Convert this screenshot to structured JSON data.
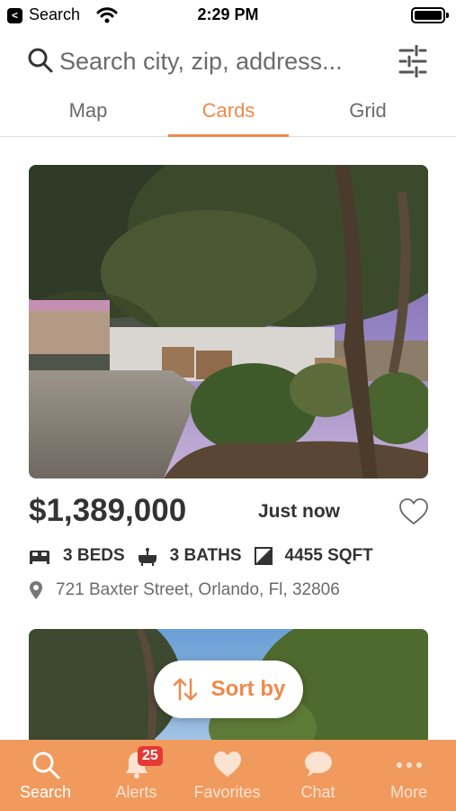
{
  "status_bar": {
    "back_glyph": "<",
    "back_label": "Search",
    "time": "2:29 PM",
    "icons": [
      "wifi-icon",
      "battery-icon"
    ]
  },
  "search": {
    "placeholder": "Search city, zip, address...",
    "icons": [
      "search-icon",
      "filter-sliders-icon"
    ]
  },
  "tabs": [
    {
      "label": "Map",
      "active": false
    },
    {
      "label": "Cards",
      "active": true
    },
    {
      "label": "Grid",
      "active": false
    }
  ],
  "listings": [
    {
      "price": "$1,389,000",
      "posted": "Just now",
      "beds": "3 BEDS",
      "baths": "3 BATHS",
      "sqft": "4455 SQFT",
      "address": "721 Baxter Street, Orlando, Fl, 32806",
      "favorite": false,
      "photo": "house-photo-trees-driveway"
    },
    {
      "photo": "house-photo-trees-sky"
    }
  ],
  "sort": {
    "label": "Sort by",
    "icon": "sort-arrows-icon"
  },
  "bottom_nav": [
    {
      "label": "Search",
      "icon": "search-icon",
      "active": true
    },
    {
      "label": "Alerts",
      "icon": "bell-icon",
      "badge": "25",
      "active": false
    },
    {
      "label": "Favorites",
      "icon": "heart-icon",
      "active": false
    },
    {
      "label": "Chat",
      "icon": "chat-bubble-icon",
      "active": false
    },
    {
      "label": "More",
      "icon": "more-dots-icon",
      "active": false
    }
  ],
  "colors": {
    "accent": "#ee8a4a",
    "nav_background": "#f09a5e",
    "badge": "#e53935",
    "text": "#333333",
    "muted": "#6b6b6b"
  }
}
